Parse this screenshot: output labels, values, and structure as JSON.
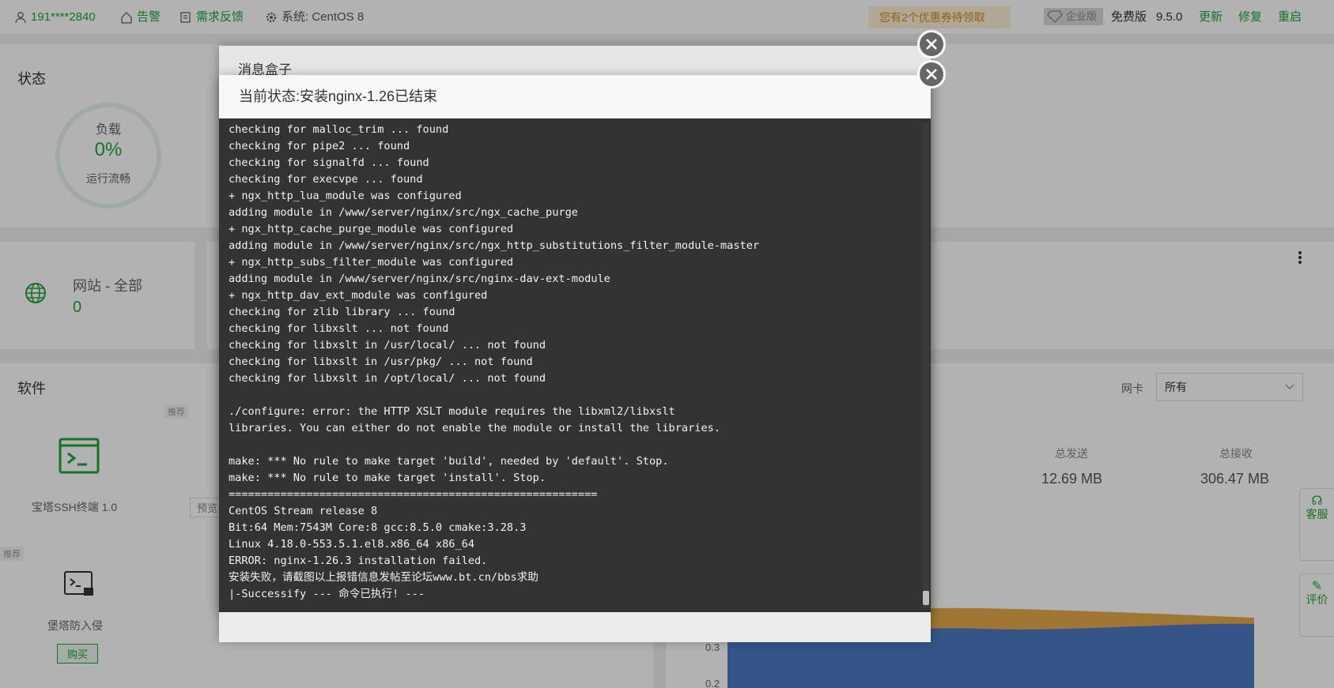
{
  "topbar": {
    "user": "191****2840",
    "alert": "告警",
    "feedback": "需求反馈",
    "system": "系统:  CentOS 8",
    "coupon": "您有2个优惠券待领取",
    "enterprise": "企业版",
    "free": "免费版",
    "version": "9.5.0",
    "update": "更新",
    "repair": "修复",
    "restart": "重启"
  },
  "status": {
    "title": "状态",
    "load_label": "负载",
    "load_value": "0%",
    "load_state": "运行流畅"
  },
  "site": {
    "label": "网站 - 全部",
    "count": "0"
  },
  "software": {
    "title": "软件",
    "tag1": "推荐",
    "item1": "宝塔SSH终端 1.0",
    "preview_btn": "预览",
    "tag2": "推荐",
    "item2": "堡塔防入侵",
    "buy_btn": "购买"
  },
  "traffic": {
    "nic_label": "网卡",
    "nic_value": "所有",
    "sent_label": "总发送",
    "sent_value": "12.69 MB",
    "recv_label": "总接收",
    "recv_value": "306.47 MB",
    "y_ticks": [
      "0.3",
      "0.2"
    ]
  },
  "side_tabs": {
    "service": "客服",
    "review": "评价"
  },
  "colors": {
    "accent": "#20a53a",
    "terminal_bg": "#333333",
    "chart_orange": "#e4a94b",
    "chart_blue": "#4d7ac4"
  },
  "message_box": {
    "title": "消息盒子"
  },
  "dialog": {
    "status": "当前状态:安装nginx-1.26已结束",
    "log": "checking for malloc_trim ... found\nchecking for pipe2 ... found\nchecking for signalfd ... found\nchecking for execvpe ... found\n+ ngx_http_lua_module was configured\nadding module in /www/server/nginx/src/ngx_cache_purge\n+ ngx_http_cache_purge_module was configured\nadding module in /www/server/nginx/src/ngx_http_substitutions_filter_module-master\n+ ngx_http_subs_filter_module was configured\nadding module in /www/server/nginx/src/nginx-dav-ext-module\n+ ngx_http_dav_ext_module was configured\nchecking for zlib library ... found\nchecking for libxslt ... not found\nchecking for libxslt in /usr/local/ ... not found\nchecking for libxslt in /usr/pkg/ ... not found\nchecking for libxslt in /opt/local/ ... not found\n\n./configure: error: the HTTP XSLT module requires the libxml2/libxslt\nlibraries. You can either do not enable the module or install the libraries.\n\nmake: *** No rule to make target 'build', needed by 'default'. Stop.\nmake: *** No rule to make target 'install'. Stop.\n=========================================================\nCentOS Stream release 8\nBit:64 Mem:7543M Core:8 gcc:8.5.0 cmake:3.28.3\nLinux 4.18.0-553.5.1.el8.x86_64 x86_64\nERROR: nginx-1.26.3 installation failed.\n安装失败，请截图以上报错信息发帖至论坛www.bt.cn/bbs求助\n|-Successify --- 命令已执行! ---"
  }
}
